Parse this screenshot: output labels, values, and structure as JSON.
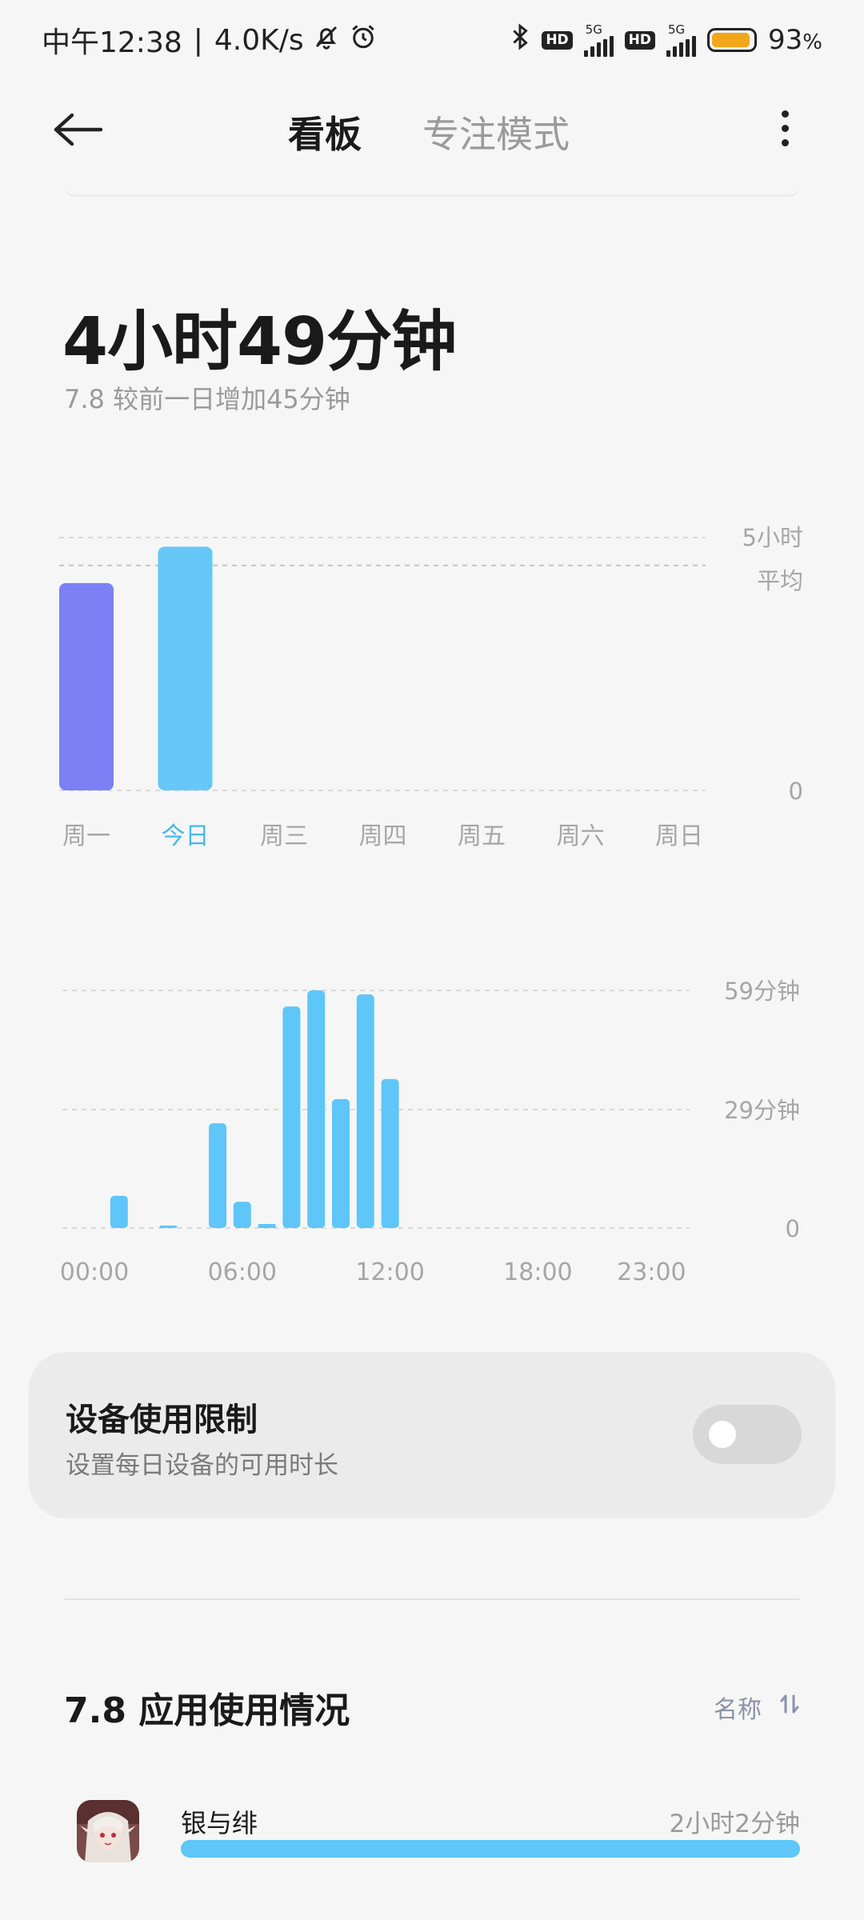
{
  "status_bar": {
    "time": "中午12:38",
    "separator": "|",
    "net_speed": "4.0K/s",
    "hd_label": "HD",
    "network_label": "5G",
    "battery_percent": "93",
    "battery_unit": "%",
    "battery_color": "#f2a61c",
    "battery_level": 0.93
  },
  "header": {
    "tab_dashboard": "看板",
    "tab_focus": "专注模式"
  },
  "summary": {
    "total": "4小时49分钟",
    "compare": "7.8  较前一日增加45分钟"
  },
  "weekly_chart_labels": {
    "y_top": "5小时",
    "avg": "平均",
    "y_zero": "0"
  },
  "hourly_chart_labels": {
    "y_top": "59分钟",
    "y_mid": "29分钟",
    "y_zero": "0"
  },
  "chart_data": [
    {
      "type": "bar",
      "categories": [
        "周一",
        "今日",
        "周三",
        "周四",
        "周五",
        "周六",
        "周日"
      ],
      "values": [
        4.1,
        4.82,
        0,
        0,
        0,
        0,
        0
      ],
      "y_unit": "小时",
      "ylim": [
        0,
        5.2
      ],
      "yticks": [
        0,
        5
      ],
      "average_line": 4.45,
      "highlight_index": 1,
      "bar_colors": [
        "#7b80f5",
        "#66c8f8"
      ],
      "highlight_label_color": "#47b8ec",
      "grid": true
    },
    {
      "type": "bar",
      "x_labels": [
        "00:00",
        "06:00",
        "12:00",
        "18:00",
        "23:00"
      ],
      "hours": [
        0,
        1,
        2,
        3,
        4,
        5,
        6,
        7,
        8,
        9,
        10,
        11,
        12,
        13,
        14,
        15,
        16,
        17,
        18,
        19,
        20,
        21,
        22,
        23
      ],
      "values": [
        0,
        8,
        0,
        0.5,
        0,
        26,
        6.5,
        1,
        55,
        59,
        32,
        58,
        37,
        0,
        0,
        0,
        0,
        0,
        0,
        0,
        0,
        0,
        0,
        0
      ],
      "y_unit": "分钟",
      "ylim": [
        0,
        60
      ],
      "yticks": [
        0,
        29,
        59
      ],
      "bar_color": "#5ec6f8",
      "grid": true
    }
  ],
  "device_limit": {
    "title": "设备使用限制",
    "subtitle": "设置每日设备的可用时长",
    "enabled": false
  },
  "app_usage": {
    "title": "7.8 应用使用情况",
    "sort_label": "名称",
    "apps": [
      {
        "name": "银与绯",
        "duration": "2小时2分钟",
        "fraction": 1.0,
        "color": "#5ec6f8"
      }
    ]
  }
}
